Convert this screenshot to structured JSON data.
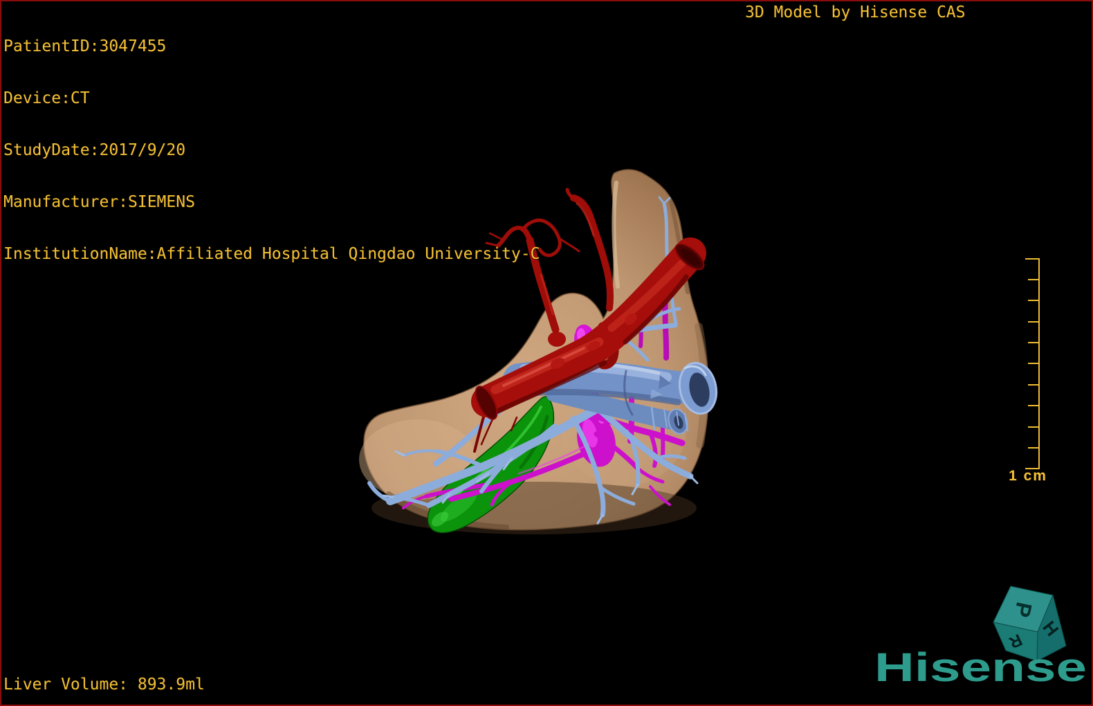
{
  "overlay": {
    "patient_info": [
      "PatientID:3047455",
      "Device:CT",
      "StudyDate:2017/9/20",
      "Manufacturer:SIEMENS",
      "InstitutionName:Affiliated Hospital Qingdao University-C"
    ],
    "view_title": "3D Model by Hisense CAS",
    "liver_volume": "Liver Volume: 893.9ml",
    "text_color": "#F3C136"
  },
  "scale_ruler": {
    "label": "1 cm",
    "divisions": 10,
    "color": "#EFBC34"
  },
  "branding": {
    "logo_text": "Hisense",
    "logo_color": "#2E9C8D"
  },
  "orientation_cube": {
    "letters": {
      "top": "P",
      "right": "H",
      "left": "R"
    },
    "face_colors": {
      "top": "#2F918C",
      "right": "#156E6B",
      "left": "#1B7B75"
    }
  },
  "model": {
    "colors": {
      "liver": "#BE9671",
      "artery": "#A50E0A",
      "portal_vein": "#7392C8",
      "portal_branches": "#8CACDC",
      "hepatic_vein": "#CC10CC",
      "gallbladder": "#0C930C"
    }
  },
  "frame": {
    "border_color": "#8A0C0C",
    "background": "#000000"
  }
}
